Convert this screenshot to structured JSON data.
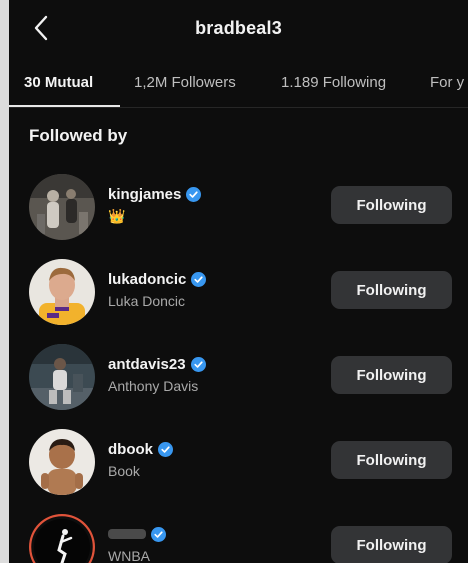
{
  "header": {
    "title": "bradbeal3"
  },
  "tabs": [
    {
      "label": "30 Mutual"
    },
    {
      "label": "1,2M Followers"
    },
    {
      "label": "1.189 Following"
    },
    {
      "label": "For y"
    }
  ],
  "section": {
    "title": "Followed by"
  },
  "users": [
    {
      "username": "kingjames",
      "subtitle": "👑",
      "button": "Following",
      "verified": true
    },
    {
      "username": "lukadoncic",
      "subtitle": "Luka Doncic",
      "button": "Following",
      "verified": true
    },
    {
      "username": "antdavis23",
      "subtitle": "Anthony Davis",
      "button": "Following",
      "verified": true
    },
    {
      "username": "dbook",
      "subtitle": "Book",
      "button": "Following",
      "verified": true
    },
    {
      "username": "",
      "subtitle": "WNBA",
      "button": "Following",
      "verified": true
    }
  ],
  "colors": {
    "verified": "#3897f0",
    "button_bg": "#333436",
    "background": "#0d0d0d"
  }
}
